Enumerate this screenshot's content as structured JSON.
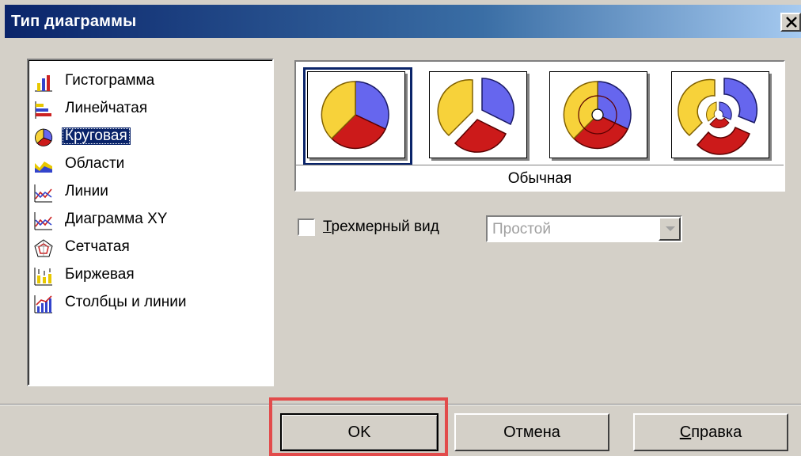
{
  "window": {
    "title": "Тип диаграммы",
    "close_label": "×"
  },
  "chart_types": [
    {
      "label": "Гистограмма",
      "icon": "bar-chart-icon"
    },
    {
      "label": "Линейчатая",
      "icon": "horizontal-bar-chart-icon"
    },
    {
      "label": "Круговая",
      "icon": "pie-chart-icon",
      "selected": true
    },
    {
      "label": "Области",
      "icon": "area-chart-icon"
    },
    {
      "label": "Линии",
      "icon": "line-chart-icon"
    },
    {
      "label": "Диаграмма XY",
      "icon": "xy-chart-icon"
    },
    {
      "label": "Сетчатая",
      "icon": "radar-chart-icon"
    },
    {
      "label": "Биржевая",
      "icon": "stock-chart-icon"
    },
    {
      "label": "Столбцы и линии",
      "icon": "column-line-chart-icon"
    }
  ],
  "subtypes": {
    "selected_label": "Обычная",
    "items": [
      "pie",
      "exploded-pie",
      "doughnut",
      "exploded-doughnut"
    ]
  },
  "options": {
    "three_d_label": "Трехмерный вид",
    "three_d_checked": false,
    "style_value": "Простой"
  },
  "buttons": {
    "ok": "OK",
    "cancel": "Отмена",
    "help": "Справка"
  },
  "colors": {
    "title_bar": "#0a246a",
    "selection": "#0a246a",
    "pie_yellow": "#f7d23a",
    "pie_blue": "#6666ee",
    "pie_red": "#cc1a1a",
    "highlight": "#e24b4b"
  }
}
